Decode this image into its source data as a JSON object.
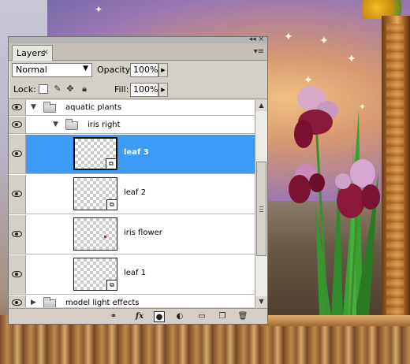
{
  "panel": {
    "tab_label": "Layers",
    "tab_close": "×",
    "blend_mode": "Normal",
    "opacity_label": "Opacity:",
    "opacity_value": "100%",
    "lock_label": "Lock:",
    "fill_label": "Fill:",
    "fill_value": "100%"
  },
  "layers": [
    {
      "name": "aquatic plants",
      "type": "group",
      "expanded": true,
      "visible": true
    },
    {
      "name": "iris right",
      "type": "group",
      "expanded": true,
      "visible": true
    },
    {
      "name": "leaf 3",
      "type": "smart-object",
      "selected": true,
      "visible": true
    },
    {
      "name": "leaf 2",
      "type": "smart-object",
      "selected": false,
      "visible": true
    },
    {
      "name": "iris flower",
      "type": "layer",
      "selected": false,
      "visible": true
    },
    {
      "name": "leaf 1",
      "type": "smart-object",
      "selected": false,
      "visible": true
    },
    {
      "name": "model light effects",
      "type": "group",
      "expanded": false,
      "visible": true
    }
  ],
  "bottom_icons": [
    "link-icon",
    "fx-icon",
    "mask-icon",
    "adjustment-icon",
    "folder-icon",
    "new-layer-icon",
    "trash-icon"
  ],
  "colors": {
    "selection": "#3d9af5",
    "panel_bg": "#d4d0c8"
  }
}
